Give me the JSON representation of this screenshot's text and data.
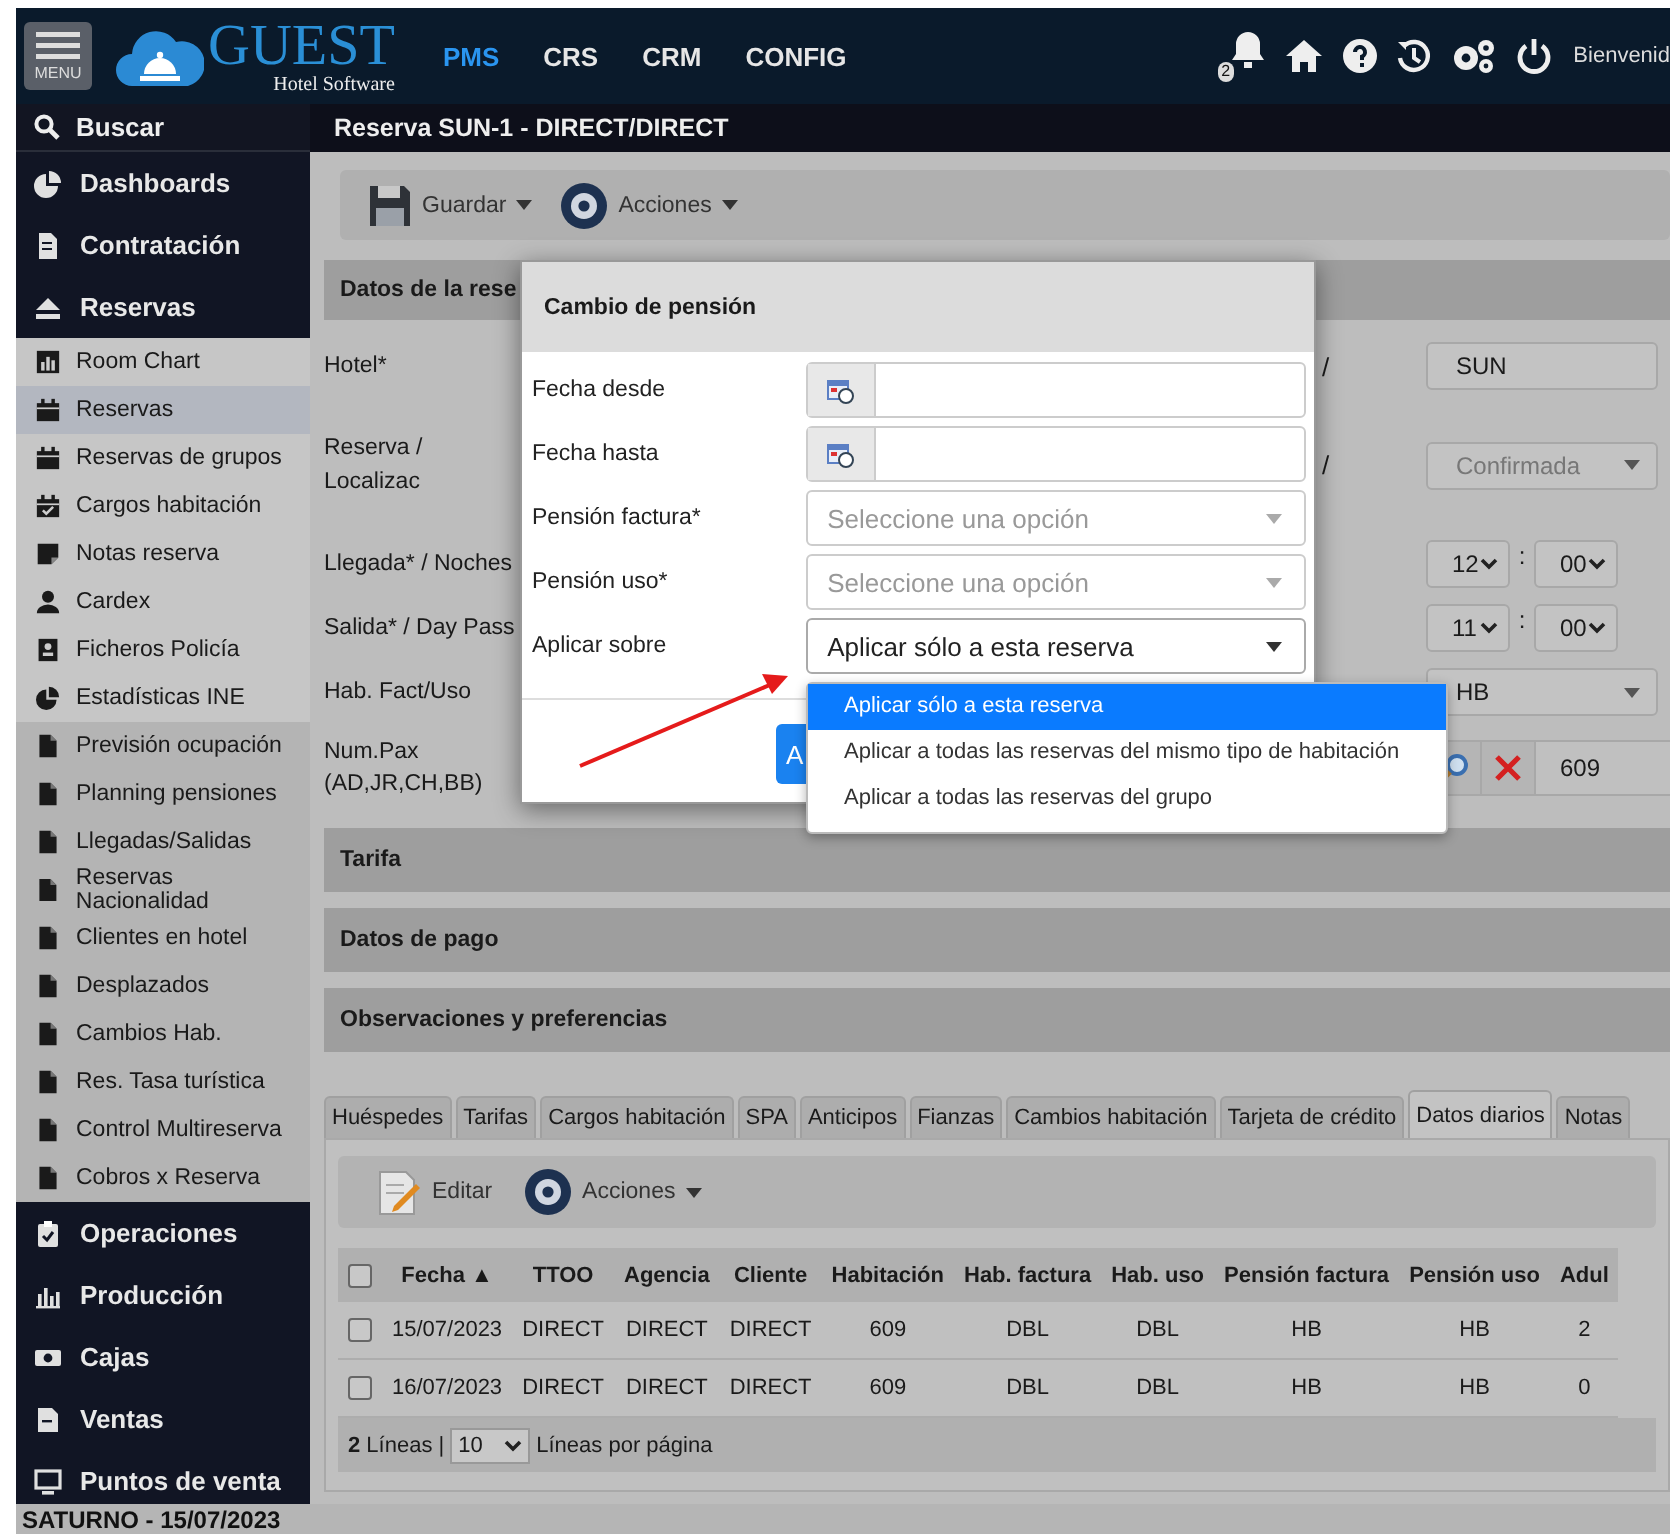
{
  "header": {
    "menu_label": "MENU",
    "logo_title": "GUEST",
    "logo_subtitle": "Hotel Software",
    "nav": [
      {
        "label": "PMS",
        "selected": true
      },
      {
        "label": "CRS",
        "selected": false
      },
      {
        "label": "CRM",
        "selected": false
      },
      {
        "label": "CONFIG",
        "selected": false
      }
    ],
    "notification_count": "2",
    "welcome": "Bienvenid"
  },
  "search_label": "Buscar",
  "page_title": "Reserva SUN-1 - DIRECT/DIRECT",
  "sidebar": {
    "items": [
      {
        "label": "Dashboards"
      },
      {
        "label": "Contratación"
      },
      {
        "label": "Reservas",
        "expanded": true,
        "children": [
          {
            "label": "Room Chart",
            "kind": "menu",
            "selected": false
          },
          {
            "label": "Reservas",
            "kind": "menu",
            "selected": true
          },
          {
            "label": "Reservas de grupos",
            "kind": "menu",
            "selected": false
          },
          {
            "label": "Cargos habitación",
            "kind": "menu",
            "selected": false
          },
          {
            "label": "Notas reserva",
            "kind": "menu",
            "selected": false
          },
          {
            "label": "Cardex",
            "kind": "menu",
            "selected": false
          },
          {
            "label": "Ficheros Policía",
            "kind": "menu",
            "selected": false
          },
          {
            "label": "Estadísticas INE",
            "kind": "menu",
            "selected": false
          },
          {
            "label": "Previsión ocupación",
            "kind": "report",
            "selected": false
          },
          {
            "label": "Planning pensiones",
            "kind": "report",
            "selected": false
          },
          {
            "label": "Llegadas/Salidas",
            "kind": "report",
            "selected": false
          },
          {
            "label": "Reservas Nacionalidad",
            "kind": "report",
            "selected": false
          },
          {
            "label": "Clientes en hotel",
            "kind": "report",
            "selected": false
          },
          {
            "label": "Desplazados",
            "kind": "report",
            "selected": false
          },
          {
            "label": "Cambios Hab.",
            "kind": "report",
            "selected": false
          },
          {
            "label": "Res. Tasa turística",
            "kind": "report",
            "selected": false
          },
          {
            "label": "Control Multireserva",
            "kind": "report",
            "selected": false
          },
          {
            "label": "Cobros x Reserva",
            "kind": "report",
            "selected": false
          }
        ]
      },
      {
        "label": "Operaciones"
      },
      {
        "label": "Producción"
      },
      {
        "label": "Cajas"
      },
      {
        "label": "Ventas"
      },
      {
        "label": "Puntos de venta"
      }
    ]
  },
  "toolbar": [
    {
      "label": "Guardar",
      "kind": "save"
    },
    {
      "label": "Acciones",
      "kind": "actions"
    }
  ],
  "reservation_section": {
    "title": "Datos de la rese",
    "rows": [
      {
        "label": "Hotel*",
        "kind": "text",
        "separator": "/",
        "value": "SUN"
      },
      {
        "label": "Reserva / Localizac",
        "kind": "select",
        "separator": "/",
        "value": "Confirmada",
        "disabled": true
      },
      {
        "label": "Llegada* / Noches",
        "kind": "time",
        "hour": "12",
        "time_separator": ":",
        "minute": "00"
      },
      {
        "label": "Salida* / Day Pass",
        "kind": "time",
        "hour": "11",
        "time_separator": ":",
        "minute": "00"
      },
      {
        "label": "Hab. Fact/Uso",
        "kind": "select",
        "value": "HB",
        "disabled": false
      },
      {
        "label": "Num.Pax (AD,JR,CH,BB)",
        "kind": "room",
        "value": "609"
      }
    ]
  },
  "collapsed_sections": [
    "Tarifa",
    "Datos de pago",
    "Observaciones y preferencias"
  ],
  "tabs": [
    {
      "label": "Huéspedes",
      "selected": false
    },
    {
      "label": "Tarifas",
      "selected": false
    },
    {
      "label": "Cargos habitación",
      "selected": false
    },
    {
      "label": "SPA",
      "selected": false
    },
    {
      "label": "Anticipos",
      "selected": false
    },
    {
      "label": "Fianzas",
      "selected": false
    },
    {
      "label": "Cambios habitación",
      "selected": false
    },
    {
      "label": "Tarjeta de crédito",
      "selected": false
    },
    {
      "label": "Datos diarios",
      "selected": true
    },
    {
      "label": "Notas",
      "selected": false
    }
  ],
  "tab_toolbar": [
    {
      "label": "Editar",
      "kind": "edit"
    },
    {
      "label": "Acciones",
      "kind": "actions"
    }
  ],
  "table": {
    "all_checked": false,
    "columns": [
      "Fecha ▲",
      "TTOO",
      "Agencia",
      "Cliente",
      "Habitación",
      "Hab. factura",
      "Hab. uso",
      "Pensión factura",
      "Pensión uso",
      "Adul"
    ],
    "rows": [
      {
        "checked": false,
        "cells": [
          "15/07/2023",
          "DIRECT",
          "DIRECT",
          "DIRECT",
          "609",
          "DBL",
          "DBL",
          "HB",
          "HB",
          "2"
        ]
      },
      {
        "checked": false,
        "cells": [
          "16/07/2023",
          "DIRECT",
          "DIRECT",
          "DIRECT",
          "609",
          "DBL",
          "DBL",
          "HB",
          "HB",
          "0"
        ]
      }
    ],
    "footer_count": "**2** Líneas |",
    "page_size": "10",
    "footer_label": "Líneas por página"
  },
  "modal": {
    "title": "Cambio de pensión",
    "fields": [
      {
        "label": "Fecha desde",
        "kind": "date"
      },
      {
        "label": "Fecha hasta",
        "kind": "date"
      },
      {
        "label": "Pensión factura*",
        "kind": "select",
        "placeholder": "Seleccione una opción",
        "expanded": false
      },
      {
        "label": "Pensión uso*",
        "kind": "select",
        "placeholder": "Seleccione una opción",
        "expanded": false
      },
      {
        "label": "Aplicar sobre",
        "kind": "select",
        "value": "Aplicar sólo a esta reserva",
        "expanded": true
      }
    ],
    "footer_button": "A",
    "options": [
      {
        "label": "Aplicar sólo a esta reserva",
        "selected": true
      },
      {
        "label": "Aplicar a todas las reservas del mismo tipo de habitación",
        "selected": false
      },
      {
        "label": "Aplicar a todas las reservas del grupo",
        "selected": false
      }
    ]
  },
  "status_bar": "SATURNO - 15/07/2023"
}
